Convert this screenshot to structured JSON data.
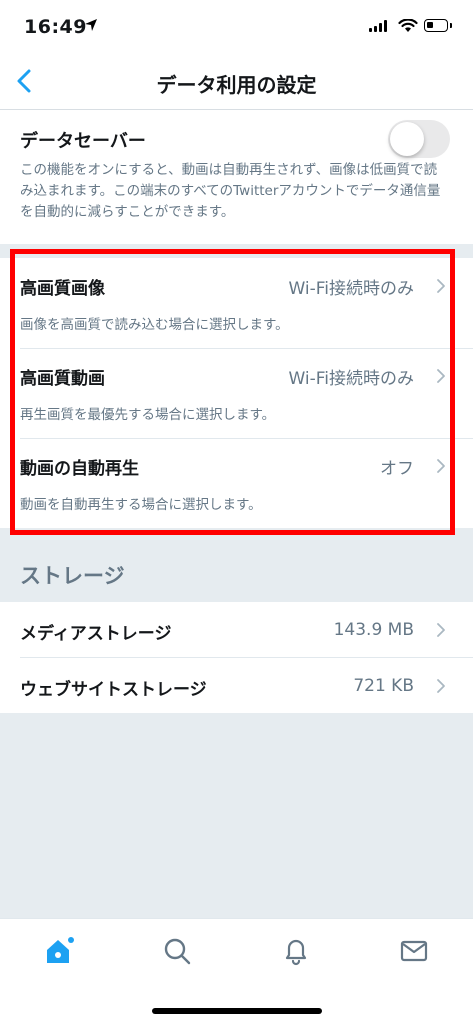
{
  "status_bar": {
    "time": "16:49"
  },
  "nav": {
    "title": "データ利用の設定"
  },
  "data_saver": {
    "title": "データセーバー",
    "enabled": false,
    "description": "この機能をオンにすると、動画は自動再生されず、画像は低画質で読み込まれます。この端末のすべてのTwitterアカウントでデータ通信量を自動的に減らすことができます。"
  },
  "media_settings": [
    {
      "title": "高画質画像",
      "value": "Wi-Fi接続時のみ",
      "description": "画像を高画質で読み込む場合に選択します。"
    },
    {
      "title": "高画質動画",
      "value": "Wi-Fi接続時のみ",
      "description": "再生画質を最優先する場合に選択します。"
    },
    {
      "title": "動画の自動再生",
      "value": "オフ",
      "description": "動画を自動再生する場合に選択します。"
    }
  ],
  "storage": {
    "header": "ストレージ",
    "items": [
      {
        "title": "メディアストレージ",
        "value": "143.9 MB"
      },
      {
        "title": "ウェブサイトストレージ",
        "value": "721 KB"
      }
    ]
  },
  "tab_bar": {
    "icons": [
      "home-icon",
      "search-icon",
      "notifications-icon",
      "messages-icon"
    ],
    "active": "home-icon"
  },
  "colors": {
    "accent": "#1da1f2",
    "highlight_box": "#ff0000",
    "secondary_text": "#657786",
    "background": "#e6ecf0"
  }
}
